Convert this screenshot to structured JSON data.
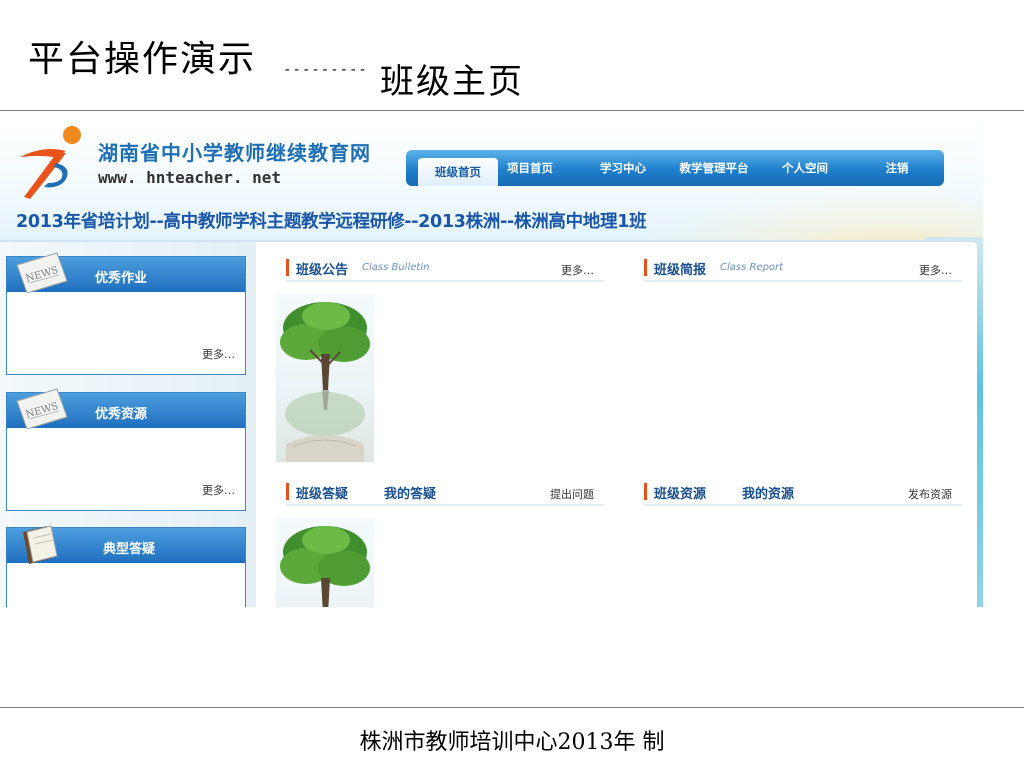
{
  "slide": {
    "title": "平台操作演示",
    "dashes": "---------",
    "subtitle": "班级主页",
    "footer": "株洲市教师培训中心2013年 制"
  },
  "site": {
    "name": "湖南省中小学教师继续教育网",
    "url": "www. hnteacher. net",
    "class_title": "2013年省培计划--高中教师学科主题教学远程研修--2013株洲--株洲高中地理1班",
    "colors": {
      "brand_blue": "#1f6fb5",
      "nav_blue": "#1f7fcb",
      "accent_orange": "#e0531c"
    }
  },
  "nav": {
    "items": [
      {
        "label": "班级首页",
        "active": true
      },
      {
        "label": "项目首页",
        "active": false
      },
      {
        "label": "学习中心",
        "active": false
      },
      {
        "label": "教学管理平台",
        "active": false
      },
      {
        "label": "个人空间",
        "active": false
      },
      {
        "label": "注销",
        "active": false
      }
    ]
  },
  "sidebar": {
    "boxes": [
      {
        "title": "优秀作业",
        "more": "更多…",
        "icon": "news-icon"
      },
      {
        "title": "优秀资源",
        "more": "更多…",
        "icon": "news-icon"
      },
      {
        "title": "典型答疑",
        "icon": "book-icon"
      }
    ]
  },
  "sections": {
    "bulletin": {
      "title": "班级公告",
      "english": "Class Bulletin",
      "link": "更多…"
    },
    "report": {
      "title": "班级简报",
      "english": "Class Report",
      "link": "更多…"
    },
    "qa": {
      "title": "班级答疑",
      "tab": "我的答疑",
      "link": "提出问题"
    },
    "resources": {
      "title": "班级资源",
      "tab": "我的资源",
      "link": "发布资源"
    }
  }
}
